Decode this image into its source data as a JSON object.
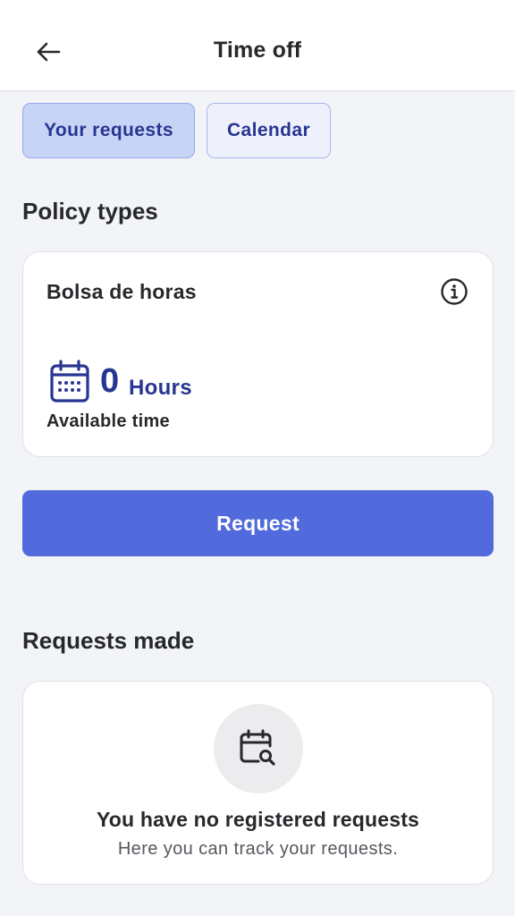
{
  "header": {
    "title": "Time off",
    "back_icon": "arrow-left-icon"
  },
  "tabs": [
    {
      "label": "Your requests",
      "active": true
    },
    {
      "label": "Calendar",
      "active": false
    }
  ],
  "policy_section": {
    "title": "Policy types",
    "policy": {
      "name": "Bolsa de horas",
      "info_icon": "info-icon",
      "calendar_icon": "calendar-icon",
      "amount": "0",
      "unit": "Hours",
      "caption": "Available time"
    }
  },
  "request_button": {
    "label": "Request"
  },
  "requests_section": {
    "title": "Requests made",
    "empty_icon": "calendar-search-icon",
    "empty_title": "You have no registered requests",
    "empty_subtitle": "Here you can track your requests."
  },
  "colors": {
    "accent": "#516bdc",
    "accent_text": "#283593",
    "tab_active_bg": "#c8d4f5",
    "background": "#f3f4f7"
  }
}
